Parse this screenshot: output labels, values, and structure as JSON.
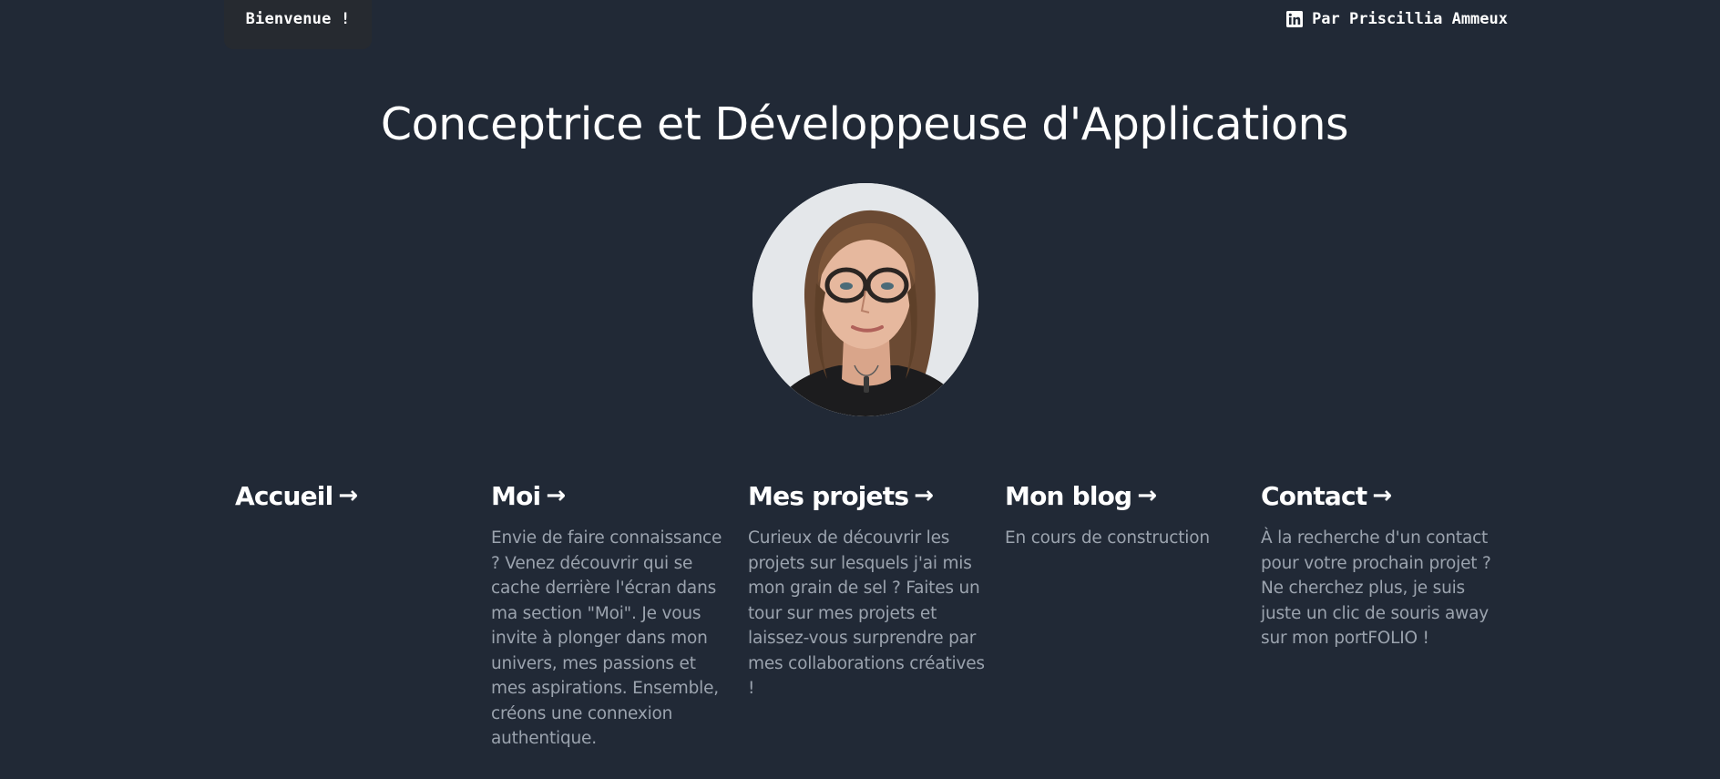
{
  "header": {
    "welcome": "Bienvenue !",
    "author": "Par Priscillia Ammeux",
    "author_icon": "linkedin-icon"
  },
  "hero": {
    "title": "Conceptrice et Développeuse d'Applications",
    "avatar_icon": "profile-photo"
  },
  "cards": [
    {
      "title": "Accueil",
      "arrow": "→",
      "text": ""
    },
    {
      "title": "Moi",
      "arrow": "→",
      "text": "Envie de faire connaissance ? Venez découvrir qui se cache derrière l'écran dans ma section \"Moi\". Je vous invite à plonger dans mon univers, mes passions et mes aspirations. Ensemble, créons une connexion authentique."
    },
    {
      "title": "Mes projets",
      "arrow": "→",
      "text": "Curieux de découvrir les projets sur lesquels j'ai mis mon grain de sel ? Faites un tour sur mes projets et laissez-vous surprendre par mes collaborations créatives !"
    },
    {
      "title": "Mon blog",
      "arrow": "→",
      "text": "En cours de construction"
    },
    {
      "title": "Contact",
      "arrow": "→",
      "text": "À la recherche d'un contact pour votre prochain projet ? Ne cherchez plus, je suis juste un clic de souris away sur mon portFOLIO !"
    }
  ],
  "colors": {
    "background": "#212936",
    "text": "#ffffff",
    "muted_text": "#9ba3ae",
    "pill": "#262a30"
  }
}
